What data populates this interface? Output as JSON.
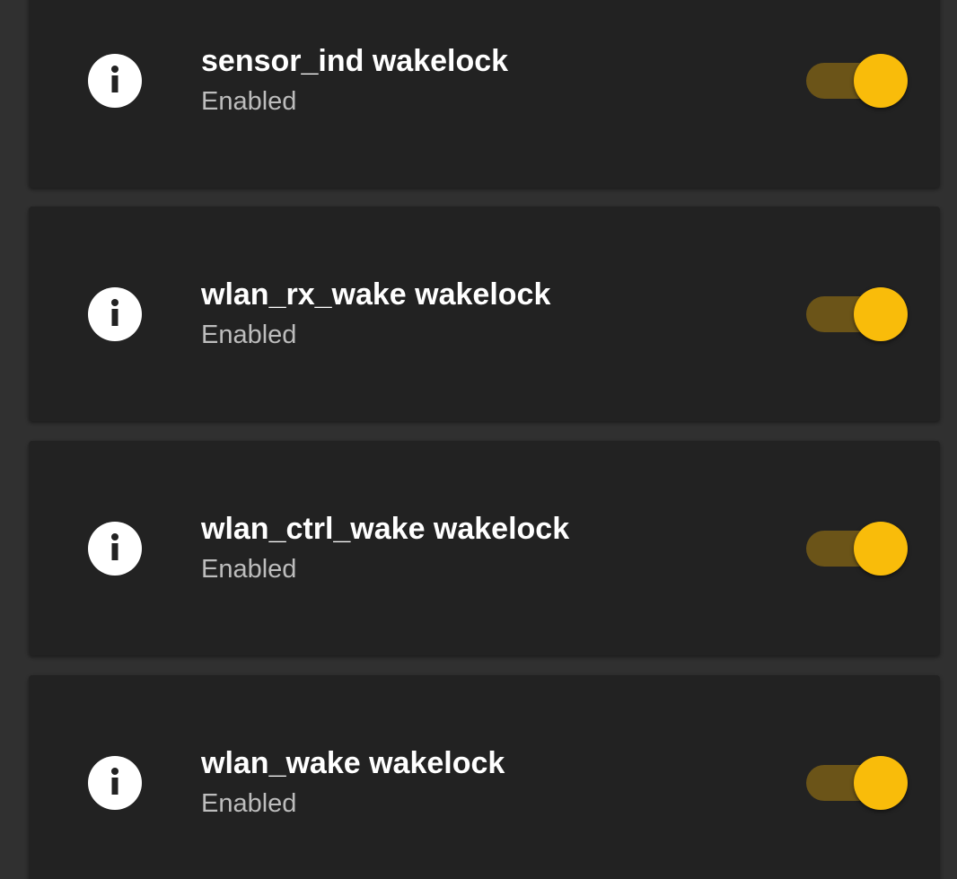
{
  "colors": {
    "background": "#303030",
    "card": "#222222",
    "accent": "#f9bc0a",
    "track_on": "#6b5418",
    "title_text": "#ffffff",
    "subtitle_text": "#bdbdbd"
  },
  "items": [
    {
      "title": "sensor_ind wakelock",
      "status": "Enabled",
      "icon": "info-icon",
      "enabled": true
    },
    {
      "title": "wlan_rx_wake wakelock",
      "status": "Enabled",
      "icon": "info-icon",
      "enabled": true
    },
    {
      "title": "wlan_ctrl_wake wakelock",
      "status": "Enabled",
      "icon": "info-icon",
      "enabled": true
    },
    {
      "title": "wlan_wake wakelock",
      "status": "Enabled",
      "icon": "info-icon",
      "enabled": true
    }
  ]
}
